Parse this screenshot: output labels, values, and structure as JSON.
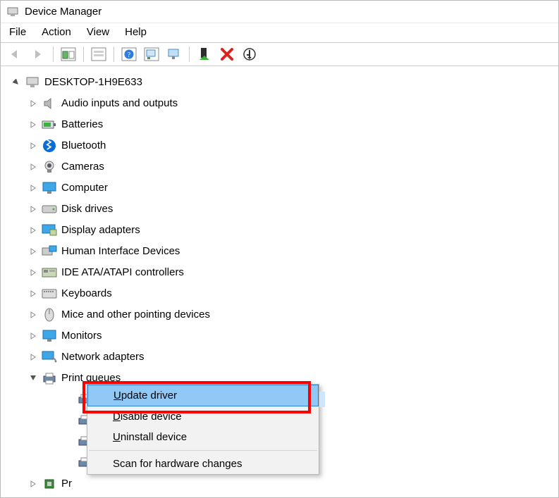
{
  "title": "Device Manager",
  "menu": {
    "file": "File",
    "action": "Action",
    "view": "View",
    "help": "Help"
  },
  "root": {
    "label": "DESKTOP-1H9E633"
  },
  "nodes": [
    {
      "label": "Audio inputs and outputs",
      "icon": "speaker"
    },
    {
      "label": "Batteries",
      "icon": "battery"
    },
    {
      "label": "Bluetooth",
      "icon": "bluetooth"
    },
    {
      "label": "Cameras",
      "icon": "camera"
    },
    {
      "label": "Computer",
      "icon": "monitor"
    },
    {
      "label": "Disk drives",
      "icon": "disk"
    },
    {
      "label": "Display adapters",
      "icon": "display"
    },
    {
      "label": "Human Interface Devices",
      "icon": "hid"
    },
    {
      "label": "IDE ATA/ATAPI controllers",
      "icon": "ide"
    },
    {
      "label": "Keyboards",
      "icon": "keyboard"
    },
    {
      "label": "Mice and other pointing devices",
      "icon": "mouse"
    },
    {
      "label": "Monitors",
      "icon": "monitor"
    },
    {
      "label": "Network adapters",
      "icon": "network"
    },
    {
      "label": "Print queues",
      "icon": "printer",
      "expanded": true
    }
  ],
  "truncated_child": "Pr",
  "ctx": {
    "update": "Update driver",
    "disable": "Disable device",
    "uninstall": "Uninstall device",
    "scan": "Scan for hardware changes"
  }
}
